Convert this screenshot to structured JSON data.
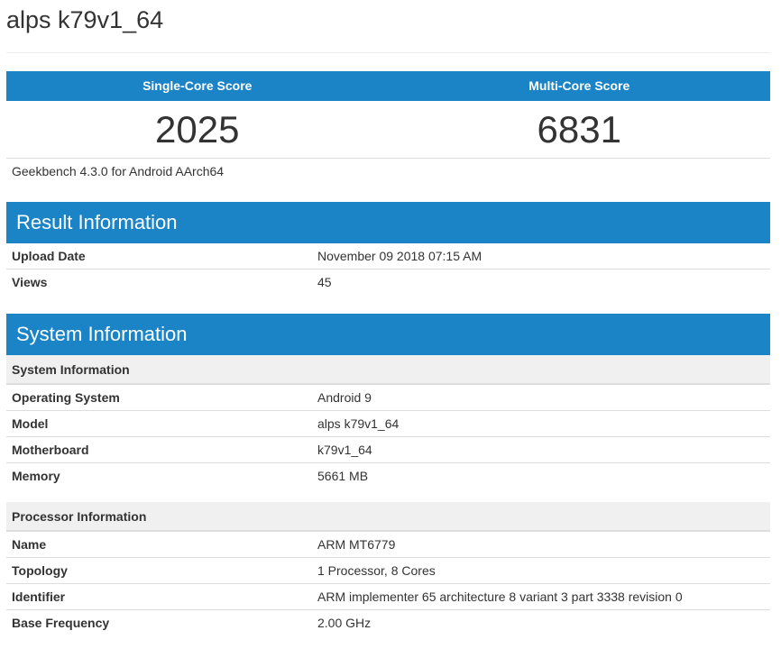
{
  "page_title": "alps k79v1_64",
  "scores": {
    "single_label": "Single-Core Score",
    "multi_label": "Multi-Core Score",
    "single_value": "2025",
    "multi_value": "6831"
  },
  "bench_version": "Geekbench 4.3.0 for Android AArch64",
  "result_info": {
    "title": "Result Information",
    "rows": [
      {
        "key": "Upload Date",
        "value": "November 09 2018 07:15 AM"
      },
      {
        "key": "Views",
        "value": "45"
      }
    ]
  },
  "system_info": {
    "title": "System Information",
    "system_subhead": "System Information",
    "system_rows": [
      {
        "key": "Operating System",
        "value": "Android 9"
      },
      {
        "key": "Model",
        "value": "alps k79v1_64"
      },
      {
        "key": "Motherboard",
        "value": "k79v1_64"
      },
      {
        "key": "Memory",
        "value": "5661 MB"
      }
    ],
    "processor_subhead": "Processor Information",
    "processor_rows": [
      {
        "key": "Name",
        "value": "ARM MT6779"
      },
      {
        "key": "Topology",
        "value": "1 Processor, 8 Cores"
      },
      {
        "key": "Identifier",
        "value": "ARM implementer 65 architecture 8 variant 3 part 3338 revision 0"
      },
      {
        "key": "Base Frequency",
        "value": "2.00 GHz"
      }
    ]
  },
  "colors": {
    "header_blue": "#1b84c7",
    "subhead_gray": "#f0f0f0",
    "text": "#333333"
  }
}
